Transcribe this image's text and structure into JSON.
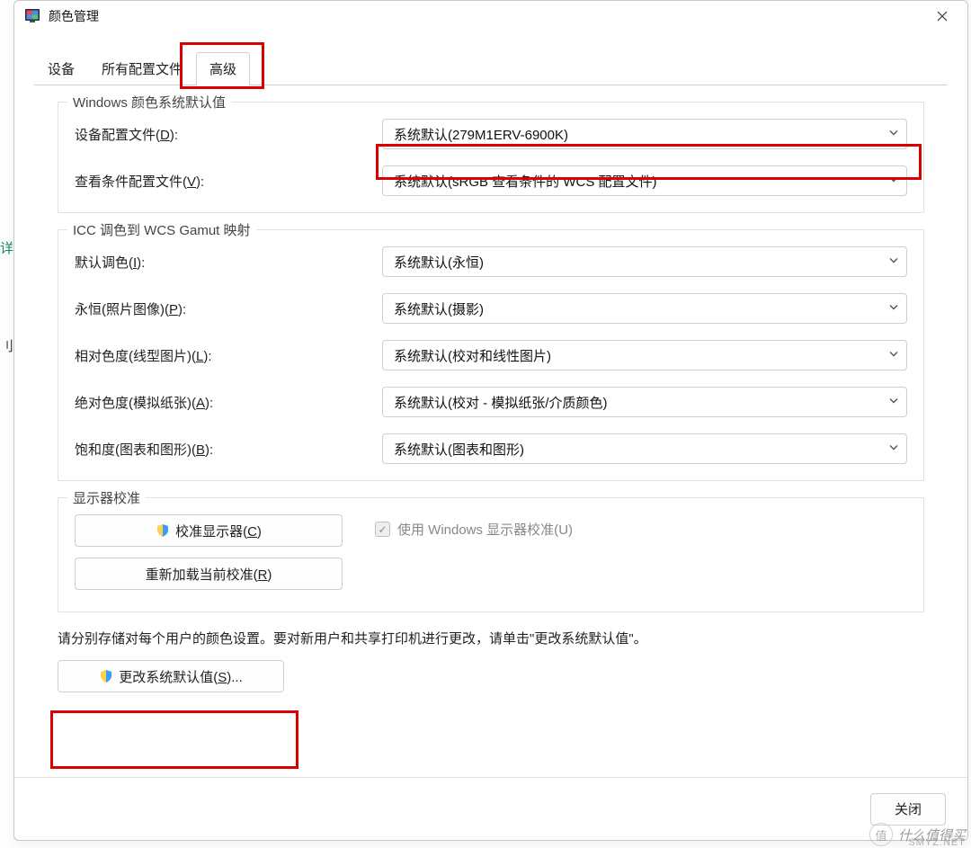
{
  "window": {
    "title": "颜色管理"
  },
  "tabs": {
    "devices": "设备",
    "allProfiles": "所有配置文件",
    "advanced": "高级"
  },
  "group1": {
    "title": "Windows 颜色系统默认值",
    "deviceProfile": {
      "label_pre": "设备配置文件(",
      "hotkey": "D",
      "label_post": "):",
      "value": "系统默认(279M1ERV-6900K)"
    },
    "viewingCond": {
      "label_pre": "查看条件配置文件(",
      "hotkey": "V",
      "label_post": "):",
      "value": "系统默认(sRGB 查看条件的 WCS 配置文件)"
    }
  },
  "group2": {
    "title": "ICC 调色到 WCS Gamut 映射",
    "defaultRendering": {
      "label_pre": "默认调色(",
      "hotkey": "I",
      "label_post": "):",
      "value": "系统默认(永恒)"
    },
    "perceptual": {
      "label_pre": "永恒(照片图像)(",
      "hotkey": "P",
      "label_post": "):",
      "value": "系统默认(摄影)"
    },
    "relative": {
      "label_pre": "相对色度(线型图片)(",
      "hotkey": "L",
      "label_post": "):",
      "value": "系统默认(校对和线性图片)"
    },
    "absolute": {
      "label_pre": "绝对色度(模拟纸张)(",
      "hotkey": "A",
      "label_post": "):",
      "value": "系统默认(校对 - 模拟纸张/介质颜色)"
    },
    "saturation": {
      "label_pre": "饱和度(图表和图形)(",
      "hotkey": "B",
      "label_post": "):",
      "value": "系统默认(图表和图形)"
    }
  },
  "group3": {
    "title": "显示器校准",
    "calibrate": {
      "label_pre": "校准显示器(",
      "hotkey": "C",
      "label_post": ")"
    },
    "reload": {
      "label_pre": "重新加载当前校准(",
      "hotkey": "R",
      "label_post": ")"
    },
    "useWindows": {
      "label_pre": "使用 Windows 显示器校准(",
      "hotkey": "U",
      "label_post": ")"
    }
  },
  "note": "请分别存储对每个用户的颜色设置。要对新用户和共享打印机进行更改，请单击\"更改系统默认值\"。",
  "changeSystemDefaults": {
    "label_pre": "更改系统默认值(",
    "hotkey": "S",
    "label_post": ")..."
  },
  "footer": {
    "close": "关闭"
  },
  "watermark": {
    "logoText": "值",
    "main": "什么值得买",
    "sub": "SMYZ.NET"
  }
}
